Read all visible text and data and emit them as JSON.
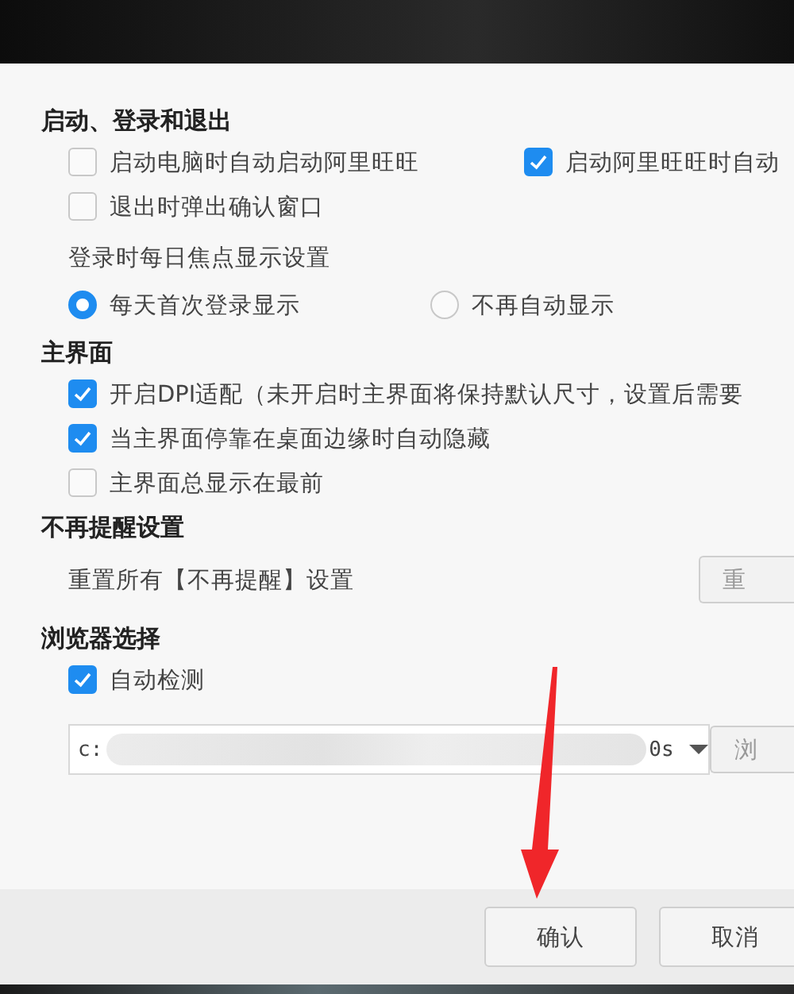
{
  "sections": [
    {
      "title": "启动、登录和退出",
      "items": [
        {
          "kind": "checks",
          "options": [
            {
              "label": "启动电脑时自动启动阿里旺旺",
              "checked": false
            },
            {
              "label": "启动阿里旺旺时自动",
              "checked": true
            }
          ]
        },
        {
          "kind": "checks",
          "options": [
            {
              "label": "退出时弹出确认窗口",
              "checked": false
            }
          ]
        },
        {
          "kind": "caption",
          "text": "登录时每日焦点显示设置"
        },
        {
          "kind": "radios",
          "options": [
            {
              "label": "每天首次登录显示",
              "selected": true
            },
            {
              "label": "不再自动显示",
              "selected": false
            }
          ]
        }
      ]
    },
    {
      "title": "主界面",
      "items": [
        {
          "kind": "checks",
          "options": [
            {
              "label": "开启DPI适配（未开启时主界面将保持默认尺寸，设置后需要",
              "checked": true
            }
          ]
        },
        {
          "kind": "checks",
          "options": [
            {
              "label": "当主界面停靠在桌面边缘时自动隐藏",
              "checked": true
            }
          ]
        },
        {
          "kind": "checks",
          "options": [
            {
              "label": "主界面总显示在最前",
              "checked": false
            }
          ]
        }
      ]
    },
    {
      "title": "不再提醒设置",
      "items": [
        {
          "kind": "reset",
          "text": "重置所有【不再提醒】设置",
          "button": "重"
        }
      ]
    },
    {
      "title": "浏览器选择",
      "items": [
        {
          "kind": "checks",
          "options": [
            {
              "label": "自动检测",
              "checked": true
            }
          ]
        },
        {
          "kind": "path",
          "prefix": "c:",
          "suffix": "0s",
          "button": "浏"
        }
      ]
    }
  ],
  "footer": {
    "buttons": [
      {
        "label": "确认"
      },
      {
        "label": "取消"
      }
    ]
  }
}
